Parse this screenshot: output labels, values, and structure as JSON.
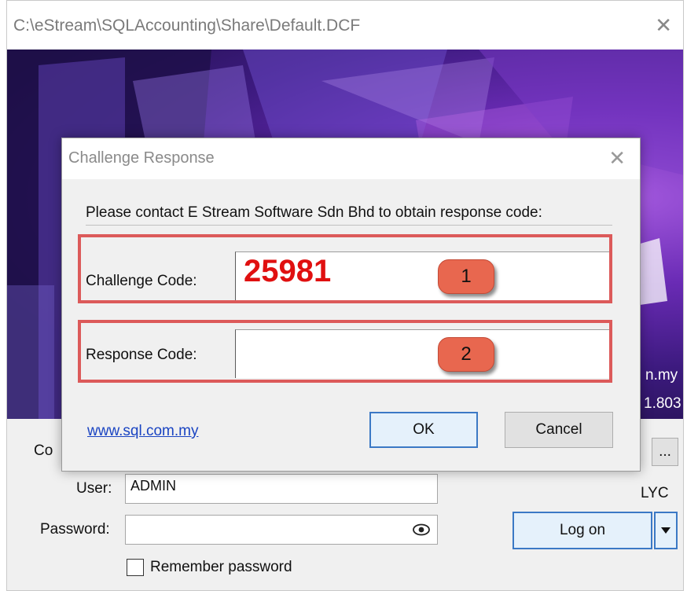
{
  "main_window": {
    "title": "C:\\eStream\\SQLAccounting\\Share\\Default.DCF",
    "close_glyph": "✕",
    "banner": {
      "right_text_1": "n.my",
      "right_text_2": "1.803"
    },
    "login": {
      "company_label_partial": "Co",
      "browse_label": "...",
      "user_label": "User:",
      "user_value": "ADMIN",
      "password_label": "Password:",
      "password_value": "",
      "eye_icon": "eye-icon",
      "remember_label": "Remember password",
      "remember_checked": false,
      "lyc_label": "LYC",
      "logon_label": "Log on",
      "dropdown_icon": "caret-down-icon"
    }
  },
  "dialog": {
    "title": "Challenge Response",
    "close_glyph": "✕",
    "message": "Please contact E Stream Software Sdn Bhd to obtain response code:",
    "challenge_label": "Challenge Code:",
    "challenge_value": "25981",
    "response_label": "Response Code:",
    "response_value": "",
    "badge_1": "1",
    "badge_2": "2",
    "link_text": "www.sql.com.my",
    "ok_label": "OK",
    "cancel_label": "Cancel",
    "colors": {
      "highlight": "#dc5a5a",
      "challenge_text": "#e01010",
      "badge": "#e8674f",
      "link": "#1a44c2"
    }
  }
}
